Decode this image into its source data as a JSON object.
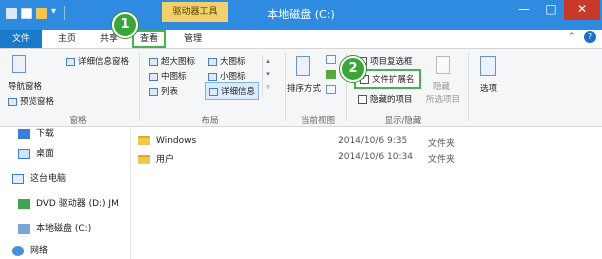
{
  "window": {
    "title": "本地磁盘 (C:)",
    "contextual_tab_group": "驱动器工具",
    "minimize_glyph": "—",
    "maximize_glyph": "□",
    "close_glyph": "✕"
  },
  "tabs": {
    "file": "文件",
    "home": "主页",
    "share": "共享",
    "view": "查看",
    "manage": "管理"
  },
  "steps": {
    "one": "1",
    "two": "2"
  },
  "ribbon": {
    "panes": {
      "nav_pane": "导航窗格",
      "preview_pane": "预览窗格",
      "details_pane": "详细信息窗格",
      "group": "窗格"
    },
    "layout": {
      "extra_large": "超大图标",
      "large": "大图标",
      "medium": "中图标",
      "small": "小图标",
      "list": "列表",
      "details": "详细信息",
      "group": "布局"
    },
    "current_view": {
      "sort_by": "排序方式",
      "group": "当前视图"
    },
    "show_hide": {
      "item_checkboxes": "项目复选框",
      "file_extensions": "文件扩展名",
      "hidden_items": "隐藏的项目",
      "hide": "隐藏",
      "selected_items": "所选项目",
      "group": "显示/隐藏"
    },
    "options": "选项"
  },
  "nav": {
    "items": [
      "下载",
      "桌面",
      "这台电脑",
      "DVD 驱动器 (D:) JM",
      "本地磁盘 (C:)",
      "网络"
    ]
  },
  "files": [
    {
      "name": "Windows",
      "date": "2014/10/6 9:35",
      "type": "文件夹"
    },
    {
      "name": "用户",
      "date": "2014/10/6 10:34",
      "type": "文件夹"
    }
  ],
  "colors": {
    "title_bar": "#2f8be0",
    "contextual_tab": "#f2d06b",
    "badge": "#3aa63a",
    "close": "#c9392a"
  }
}
